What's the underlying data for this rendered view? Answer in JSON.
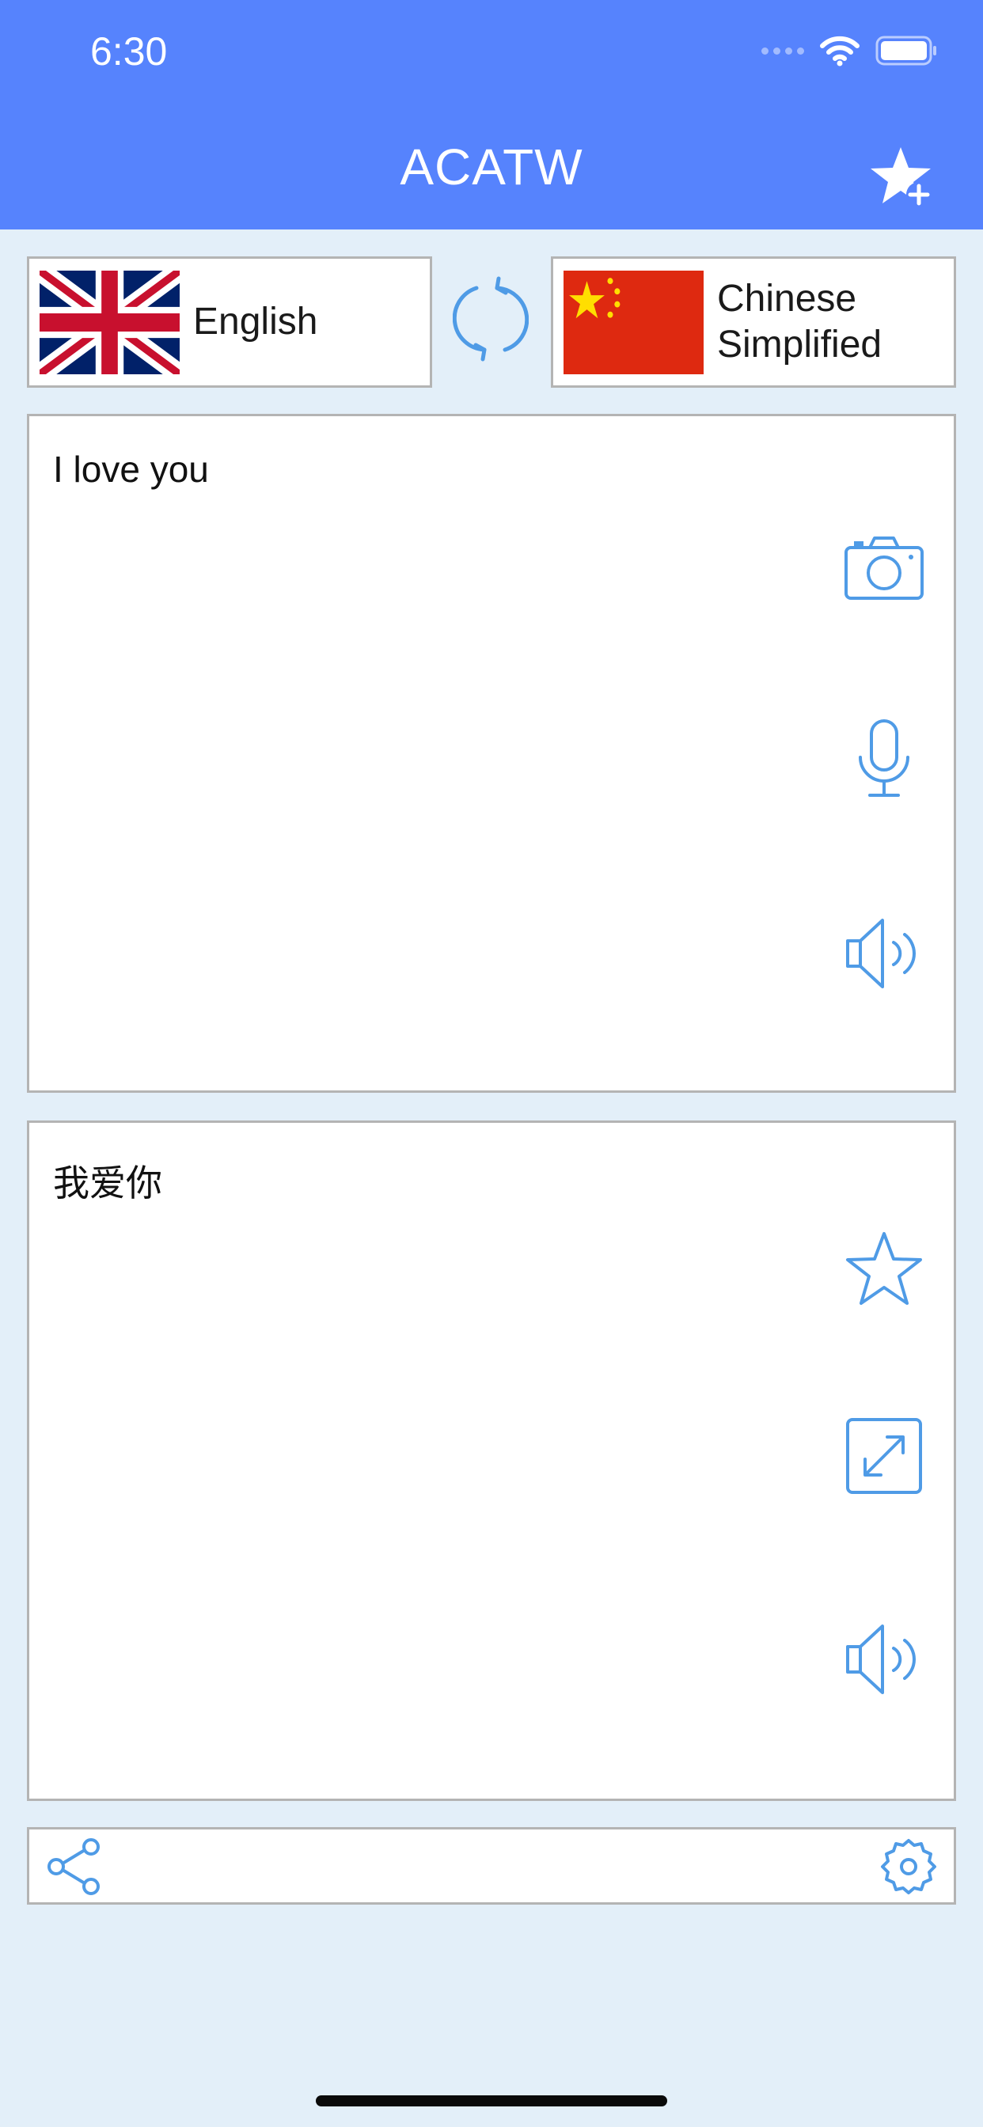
{
  "status_bar": {
    "time": "6:30"
  },
  "header": {
    "title": "ACATW",
    "favorite_add_icon": "star-plus-icon"
  },
  "languages": {
    "source": {
      "name": "English",
      "flag": "uk-flag"
    },
    "target": {
      "name_line1": "Chinese",
      "name_line2": "Simplified",
      "flag": "china-flag"
    },
    "swap_icon": "swap-arrows-icon"
  },
  "source_panel": {
    "text": "I love you",
    "icons": [
      "camera-icon",
      "microphone-icon",
      "speaker-icon"
    ]
  },
  "target_panel": {
    "text": "我爱你",
    "icons": [
      "star-icon",
      "expand-icon",
      "speaker-icon"
    ]
  },
  "toolbar": {
    "icons": [
      "share-icon",
      "settings-gear-icon"
    ]
  },
  "colors": {
    "header_bg": "#5683fd",
    "page_bg": "#e3eff9",
    "accent_icon": "#4f9be6",
    "border": "#b4b4b4"
  }
}
